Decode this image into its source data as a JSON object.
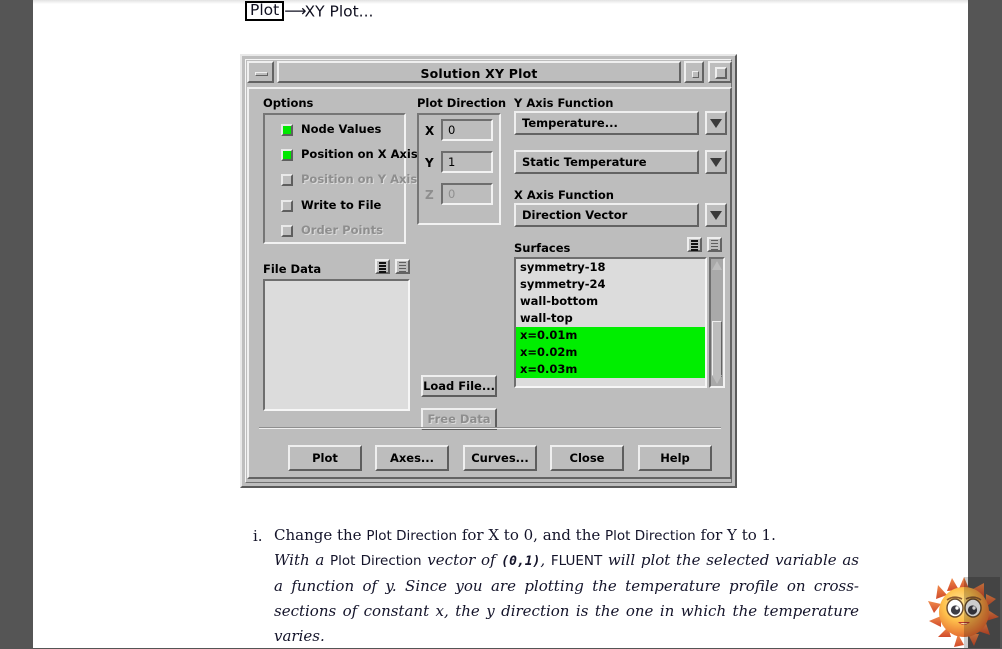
{
  "menu_path": {
    "root": "Plot",
    "arrow": "⟶",
    "leaf": "XY Plot..."
  },
  "dialog": {
    "title": "Solution XY Plot",
    "titlebar_buttons": {
      "minimize": "minimize-button",
      "restore": "restore-button",
      "maximize": "maximize-button"
    },
    "options": {
      "label": "Options",
      "items": [
        {
          "label": "Node Values",
          "checked": true,
          "enabled": true
        },
        {
          "label": "Position on X Axis",
          "checked": true,
          "enabled": true
        },
        {
          "label": "Position on Y Axis",
          "checked": false,
          "enabled": false
        },
        {
          "label": "Write to File",
          "checked": false,
          "enabled": true
        },
        {
          "label": "Order Points",
          "checked": false,
          "enabled": false
        }
      ]
    },
    "plot_direction": {
      "label": "Plot Direction",
      "fields": [
        {
          "axis": "X",
          "value": "0",
          "enabled": true
        },
        {
          "axis": "Y",
          "value": "1",
          "enabled": true
        },
        {
          "axis": "Z",
          "value": "0",
          "enabled": false
        }
      ]
    },
    "y_axis_function": {
      "label": "Y Axis Function",
      "category": "Temperature...",
      "variable": "Static Temperature"
    },
    "x_axis_function": {
      "label": "X Axis Function",
      "value": "Direction Vector"
    },
    "surfaces": {
      "label": "Surfaces",
      "items": [
        {
          "name": "symmetry-18",
          "selected": false
        },
        {
          "name": "symmetry-24",
          "selected": false
        },
        {
          "name": "wall-bottom",
          "selected": false
        },
        {
          "name": "wall-top",
          "selected": false
        },
        {
          "name": "x=0.01m",
          "selected": true
        },
        {
          "name": "x=0.02m",
          "selected": true
        },
        {
          "name": "x=0.03m",
          "selected": true
        }
      ],
      "selection_color": "#00ee00"
    },
    "file_data": {
      "label": "File Data",
      "items": [],
      "load_button": "Load File...",
      "free_button": "Free Data",
      "free_enabled": false
    },
    "action_buttons": [
      {
        "label": "Plot",
        "enabled": true
      },
      {
        "label": "Axes...",
        "enabled": true
      },
      {
        "label": "Curves...",
        "enabled": true
      },
      {
        "label": "Close",
        "enabled": true
      },
      {
        "label": "Help",
        "enabled": true
      }
    ]
  },
  "body": {
    "item_marker": "i.",
    "paragraph1": {
      "t1": "Change the ",
      "ui1": "Plot Direction",
      "t2": " for X to 0, and the ",
      "ui2": "Plot Direction",
      "t3": " for Y to 1."
    },
    "paragraph2": {
      "t1": "With a ",
      "ui1": "Plot Direction",
      "t2": " vector of ",
      "vec": "(0,1)",
      "t3": ", ",
      "ui2": "FLUENT",
      "t4": " will plot the selected variable as a function of y.  Since you are plotting the temperature profile on cross-sections of constant x, the y direction is the one in which the temperature varies."
    }
  },
  "cursor": {
    "icon": "sun-smiley-cursor"
  },
  "colors": {
    "page_background": "#555555",
    "sheet": "#ffffff",
    "dialog_face": "#bdbdbd",
    "selection_green": "#00ee00",
    "check_green": "#00e800"
  }
}
